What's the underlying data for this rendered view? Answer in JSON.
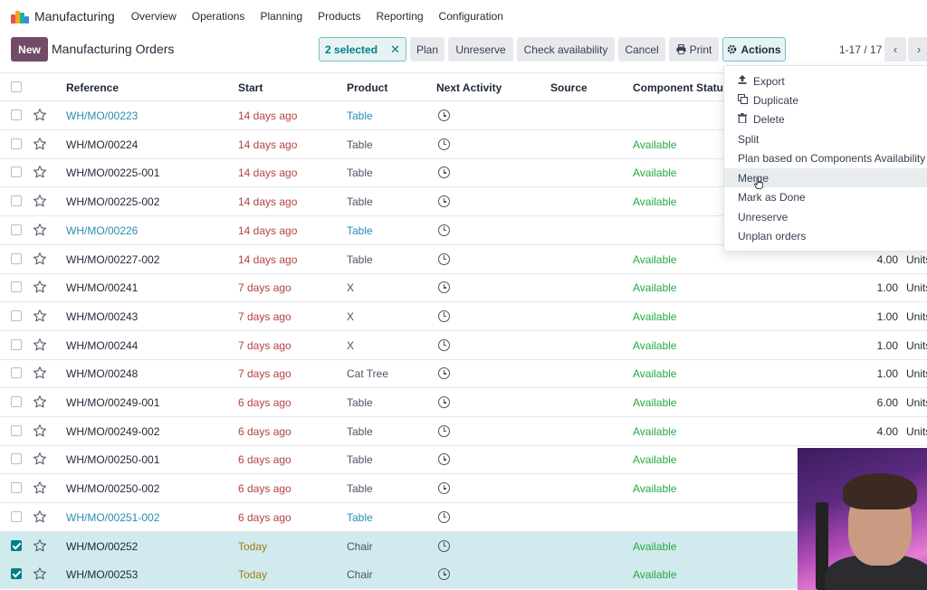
{
  "app": {
    "title": "Manufacturing",
    "logo_colors": [
      "#e94f4f",
      "#f5a623",
      "#1ab394",
      "#3b82f6"
    ]
  },
  "nav": [
    {
      "label": "Overview",
      "name": "nav-overview"
    },
    {
      "label": "Operations",
      "name": "nav-operations"
    },
    {
      "label": "Planning",
      "name": "nav-planning"
    },
    {
      "label": "Products",
      "name": "nav-products"
    },
    {
      "label": "Reporting",
      "name": "nav-reporting"
    },
    {
      "label": "Configuration",
      "name": "nav-configuration"
    }
  ],
  "toolbar": {
    "new_label": "New",
    "page_title": "Manufacturing Orders",
    "selected_label": "2 selected",
    "plan_label": "Plan",
    "unreserve_label": "Unreserve",
    "check_label": "Check availability",
    "cancel_label": "Cancel",
    "print_label": "Print",
    "actions_label": "Actions",
    "pager": "1-17 / 17"
  },
  "columns": {
    "reference": "Reference",
    "start": "Start",
    "product": "Product",
    "next_activity": "Next Activity",
    "source": "Source",
    "component_status": "Component Status"
  },
  "rows": [
    {
      "ref": "WH/MO/00223",
      "start": "14 days ago",
      "start_kind": "late",
      "product": "Table",
      "status": "",
      "qty": "",
      "unit": "",
      "link": true,
      "selected": false
    },
    {
      "ref": "WH/MO/00224",
      "start": "14 days ago",
      "start_kind": "late",
      "product": "Table",
      "status": "Available",
      "qty": "",
      "unit": "",
      "link": false,
      "selected": false
    },
    {
      "ref": "WH/MO/00225-001",
      "start": "14 days ago",
      "start_kind": "late",
      "product": "Table",
      "status": "Available",
      "qty": "",
      "unit": "",
      "link": false,
      "selected": false
    },
    {
      "ref": "WH/MO/00225-002",
      "start": "14 days ago",
      "start_kind": "late",
      "product": "Table",
      "status": "Available",
      "qty": "",
      "unit": "",
      "link": false,
      "selected": false
    },
    {
      "ref": "WH/MO/00226",
      "start": "14 days ago",
      "start_kind": "late",
      "product": "Table",
      "status": "",
      "qty": "",
      "unit": "",
      "link": true,
      "selected": false
    },
    {
      "ref": "WH/MO/00227-002",
      "start": "14 days ago",
      "start_kind": "late",
      "product": "Table",
      "status": "Available",
      "qty": "4.00",
      "unit": "Units",
      "link": false,
      "selected": false
    },
    {
      "ref": "WH/MO/00241",
      "start": "7 days ago",
      "start_kind": "late",
      "product": "X",
      "status": "Available",
      "qty": "1.00",
      "unit": "Units",
      "link": false,
      "selected": false
    },
    {
      "ref": "WH/MO/00243",
      "start": "7 days ago",
      "start_kind": "late",
      "product": "X",
      "status": "Available",
      "qty": "1.00",
      "unit": "Units",
      "link": false,
      "selected": false
    },
    {
      "ref": "WH/MO/00244",
      "start": "7 days ago",
      "start_kind": "late",
      "product": "X",
      "status": "Available",
      "qty": "1.00",
      "unit": "Units",
      "link": false,
      "selected": false
    },
    {
      "ref": "WH/MO/00248",
      "start": "7 days ago",
      "start_kind": "late",
      "product": "Cat Tree",
      "status": "Available",
      "qty": "1.00",
      "unit": "Units",
      "link": false,
      "selected": false
    },
    {
      "ref": "WH/MO/00249-001",
      "start": "6 days ago",
      "start_kind": "late",
      "product": "Table",
      "status": "Available",
      "qty": "6.00",
      "unit": "Units",
      "link": false,
      "selected": false
    },
    {
      "ref": "WH/MO/00249-002",
      "start": "6 days ago",
      "start_kind": "late",
      "product": "Table",
      "status": "Available",
      "qty": "4.00",
      "unit": "Units",
      "link": false,
      "selected": false
    },
    {
      "ref": "WH/MO/00250-001",
      "start": "6 days ago",
      "start_kind": "late",
      "product": "Table",
      "status": "Available",
      "qty": "",
      "unit": "",
      "link": false,
      "selected": false
    },
    {
      "ref": "WH/MO/00250-002",
      "start": "6 days ago",
      "start_kind": "late",
      "product": "Table",
      "status": "Available",
      "qty": "",
      "unit": "",
      "link": false,
      "selected": false
    },
    {
      "ref": "WH/MO/00251-002",
      "start": "6 days ago",
      "start_kind": "late",
      "product": "Table",
      "status": "",
      "qty": "",
      "unit": "",
      "link": true,
      "selected": false
    },
    {
      "ref": "WH/MO/00252",
      "start": "Today",
      "start_kind": "today",
      "product": "Chair",
      "status": "Available",
      "qty": "",
      "unit": "",
      "link": false,
      "selected": true
    },
    {
      "ref": "WH/MO/00253",
      "start": "Today",
      "start_kind": "today",
      "product": "Chair",
      "status": "Available",
      "qty": "",
      "unit": "",
      "link": false,
      "selected": true
    }
  ],
  "actions_menu": [
    {
      "label": "Export",
      "icon": "upload-icon"
    },
    {
      "label": "Duplicate",
      "icon": "copy-icon"
    },
    {
      "label": "Delete",
      "icon": "trash-icon"
    },
    {
      "label": "Split",
      "icon": ""
    },
    {
      "label": "Plan based on Components Availability",
      "icon": ""
    },
    {
      "label": "Merge",
      "icon": "",
      "hover": true
    },
    {
      "label": "Mark as Done",
      "icon": ""
    },
    {
      "label": "Unreserve",
      "icon": ""
    },
    {
      "label": "Unplan orders",
      "icon": ""
    }
  ]
}
